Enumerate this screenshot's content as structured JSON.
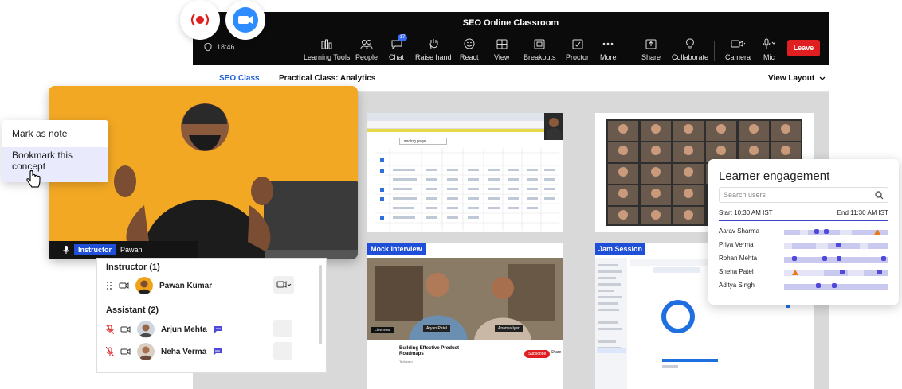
{
  "meeting": {
    "title": "SEO Online Classroom",
    "time": "18:46",
    "toolbar": [
      {
        "label": "Learning Tools",
        "icon": "learning-tools-icon"
      },
      {
        "label": "People",
        "icon": "people-icon"
      },
      {
        "label": "Chat",
        "icon": "chat-icon",
        "badge": "17"
      },
      {
        "label": "Raise hand",
        "icon": "raise-hand-icon"
      },
      {
        "label": "React",
        "icon": "react-icon"
      },
      {
        "label": "View",
        "icon": "view-icon"
      },
      {
        "label": "Breakouts",
        "icon": "breakouts-icon"
      },
      {
        "label": "Proctor",
        "icon": "proctor-icon"
      },
      {
        "label": "More",
        "icon": "more-icon"
      },
      {
        "label": "Share",
        "icon": "share-icon"
      },
      {
        "label": "Collaborate",
        "icon": "collaborate-icon"
      },
      {
        "label": "Camera",
        "icon": "camera-icon"
      },
      {
        "label": "Mic",
        "icon": "mic-icon"
      }
    ],
    "leave_label": "Leave",
    "tabs": [
      "SEO Class",
      "Practical Class: Analytics"
    ],
    "view_layout": "View Layout"
  },
  "context_menu": {
    "item1": "Mark as note",
    "item2": "Bookmark this concept"
  },
  "instructor_strip": {
    "role": "Instructor",
    "name": "Pawan"
  },
  "participants": {
    "instructor_header": "Instructor (1)",
    "instructor_name": "Pawan Kumar",
    "assistant_header": "Assistant (2)",
    "assistants": [
      "Arjun Mehta",
      "Neha Verma"
    ]
  },
  "panels": {
    "mock_interview": "Mock Interview",
    "jam_session": "Jam Session",
    "video_title": "Building Effective Product Roadmaps",
    "video_channel": "TedLearn",
    "subscribe": "Subscribe",
    "share": "Share",
    "live_now": "Live now",
    "speaker1": "Aryan Patel",
    "speaker2": "Ananya Iyer",
    "sheet_label": "Landing page"
  },
  "engagement": {
    "title": "Learner engagement",
    "search_placeholder": "Search users",
    "start": "Start 10:30 AM IST",
    "end": "End 11:30 AM IST",
    "learners": [
      "Aarav Sharma",
      "Priya Verma",
      "Rohan Mehta",
      "Sneha Patel",
      "Aditya Singh"
    ]
  },
  "colors": {
    "accent": "#1f4fd8",
    "leave": "#e02020",
    "engagement_line": "#3d48c8",
    "warning": "#e67a14"
  }
}
